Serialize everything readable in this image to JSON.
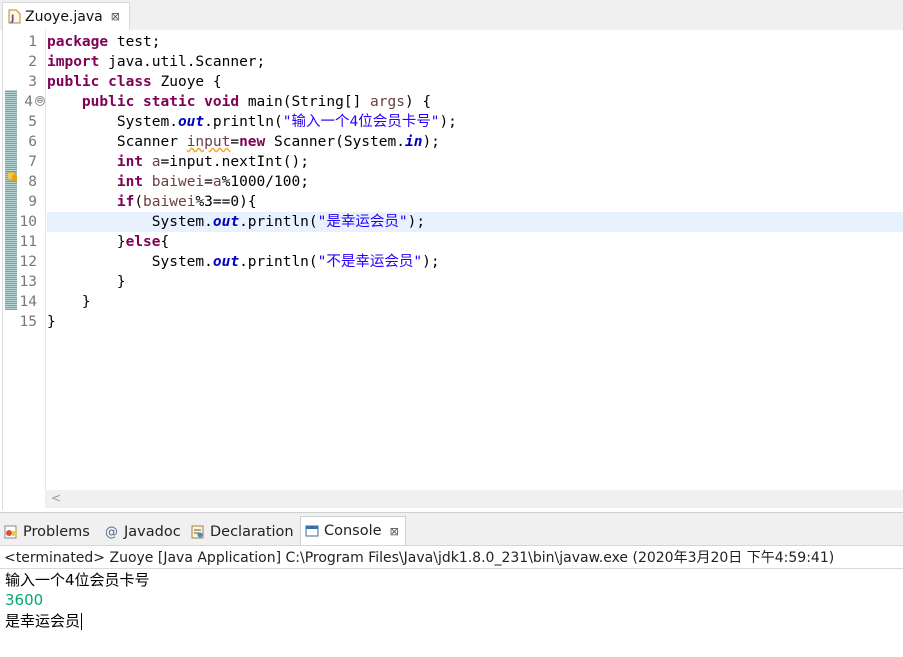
{
  "editor_tab": {
    "label": "Zuoye.java",
    "close": "⊠",
    "icon": "java-file-icon"
  },
  "line_numbers": [
    "1",
    "2",
    "3",
    "4",
    "5",
    "6",
    "7",
    "8",
    "9",
    "10",
    "11",
    "12",
    "13",
    "14",
    "15"
  ],
  "code": {
    "l1": {
      "kw": "package",
      "rest": " test;"
    },
    "l2": {
      "kw": "import",
      "rest": " java.util.Scanner;"
    },
    "l3": {
      "kw1": "public",
      "kw2": "class",
      "rest": " Zuoye {"
    },
    "l4": {
      "indent": "    ",
      "kw1": "public",
      "kw2": "static",
      "kw3": "void",
      "mid": " main(String[] ",
      "var": "args",
      "rest": ") {"
    },
    "l5": {
      "indent": "        ",
      "pre": "System.",
      "fld": "out",
      "mid": ".println(",
      "str": "\"输入一个4位会员卡号\"",
      "rest": ");"
    },
    "l6": {
      "indent": "        ",
      "pre": "Scanner ",
      "var": "input",
      "mid": "=",
      "kw": "new",
      "mid2": " Scanner(System.",
      "fld": "in",
      "rest": ");"
    },
    "l7": {
      "indent": "        ",
      "kw": "int",
      "pre": " ",
      "var": "a",
      "rest": "=input.nextInt();"
    },
    "l8": {
      "indent": "        ",
      "kw": "int",
      "pre": " ",
      "var": "baiwei",
      "mid": "=",
      "var2": "a",
      "rest": "%1000/100;"
    },
    "l9": {
      "indent": "        ",
      "kw": "if",
      "pre": "(",
      "var": "baiwei",
      "rest": "%3==0){"
    },
    "l10": {
      "indent": "            ",
      "pre": "System.",
      "fld": "out",
      "mid": ".println(",
      "str": "\"是幸运会员\"",
      "rest": ");"
    },
    "l11": {
      "indent": "        ",
      "pre": "}",
      "kw": "else",
      "rest": "{"
    },
    "l12": {
      "indent": "            ",
      "pre": "System.",
      "fld": "out",
      "mid": ".println(",
      "str": "\"不是幸运会员\"",
      "rest": ");"
    },
    "l13": {
      "text": "        }"
    },
    "l14": {
      "text": "    }"
    },
    "l15": {
      "text": "}"
    }
  },
  "fold_marker": "⊖",
  "hscroll_arrow": "<",
  "panel": {
    "tabs": [
      {
        "label": "Problems",
        "icon": "problems-icon"
      },
      {
        "label": "Javadoc",
        "icon": "at-icon",
        "glyph": "@"
      },
      {
        "label": "Declaration",
        "icon": "declaration-icon"
      },
      {
        "label": "Console",
        "icon": "console-icon",
        "close": "⊠",
        "active": true
      }
    ],
    "console_header": "<terminated> Zuoye [Java Application] C:\\Program Files\\Java\\jdk1.8.0_231\\bin\\javaw.exe (2020年3月20日 下午4:59:41)",
    "console_lines": [
      {
        "text": "输入一个4位会员卡号",
        "type": "output"
      },
      {
        "text": "3600",
        "type": "input"
      },
      {
        "text": "是幸运会员",
        "type": "output"
      }
    ]
  },
  "colors": {
    "keyword": "#7f0055",
    "string": "#2a00ff",
    "field": "#0000c0",
    "local_var": "#6a3e3e",
    "console_input": "#00a86b",
    "current_line": "#e8f2fe"
  }
}
